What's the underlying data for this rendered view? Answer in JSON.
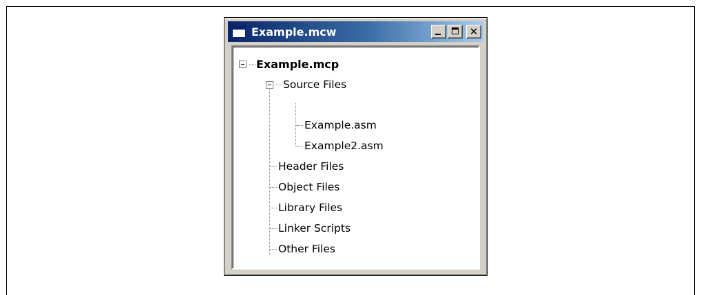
{
  "window": {
    "title": "Example.mcw",
    "buttons": {
      "minimize": "minimize-icon",
      "maximize": "maximize-icon",
      "close": "close-icon"
    }
  },
  "tree": {
    "root": {
      "label": "Example.mcp",
      "expanded": true
    },
    "source_files": {
      "label": "Source Files",
      "expanded": true
    },
    "files": [
      "Example.asm",
      "Example2.asm"
    ],
    "header_files": "Header Files",
    "object_files": "Object Files",
    "library_files": "Library Files",
    "linker_scripts": "Linker Scripts",
    "other_files": "Other Files"
  },
  "colors": {
    "titlebar_start": "#0a246a",
    "titlebar_end": "#a6caf0",
    "window_face": "#d4d0c8"
  }
}
